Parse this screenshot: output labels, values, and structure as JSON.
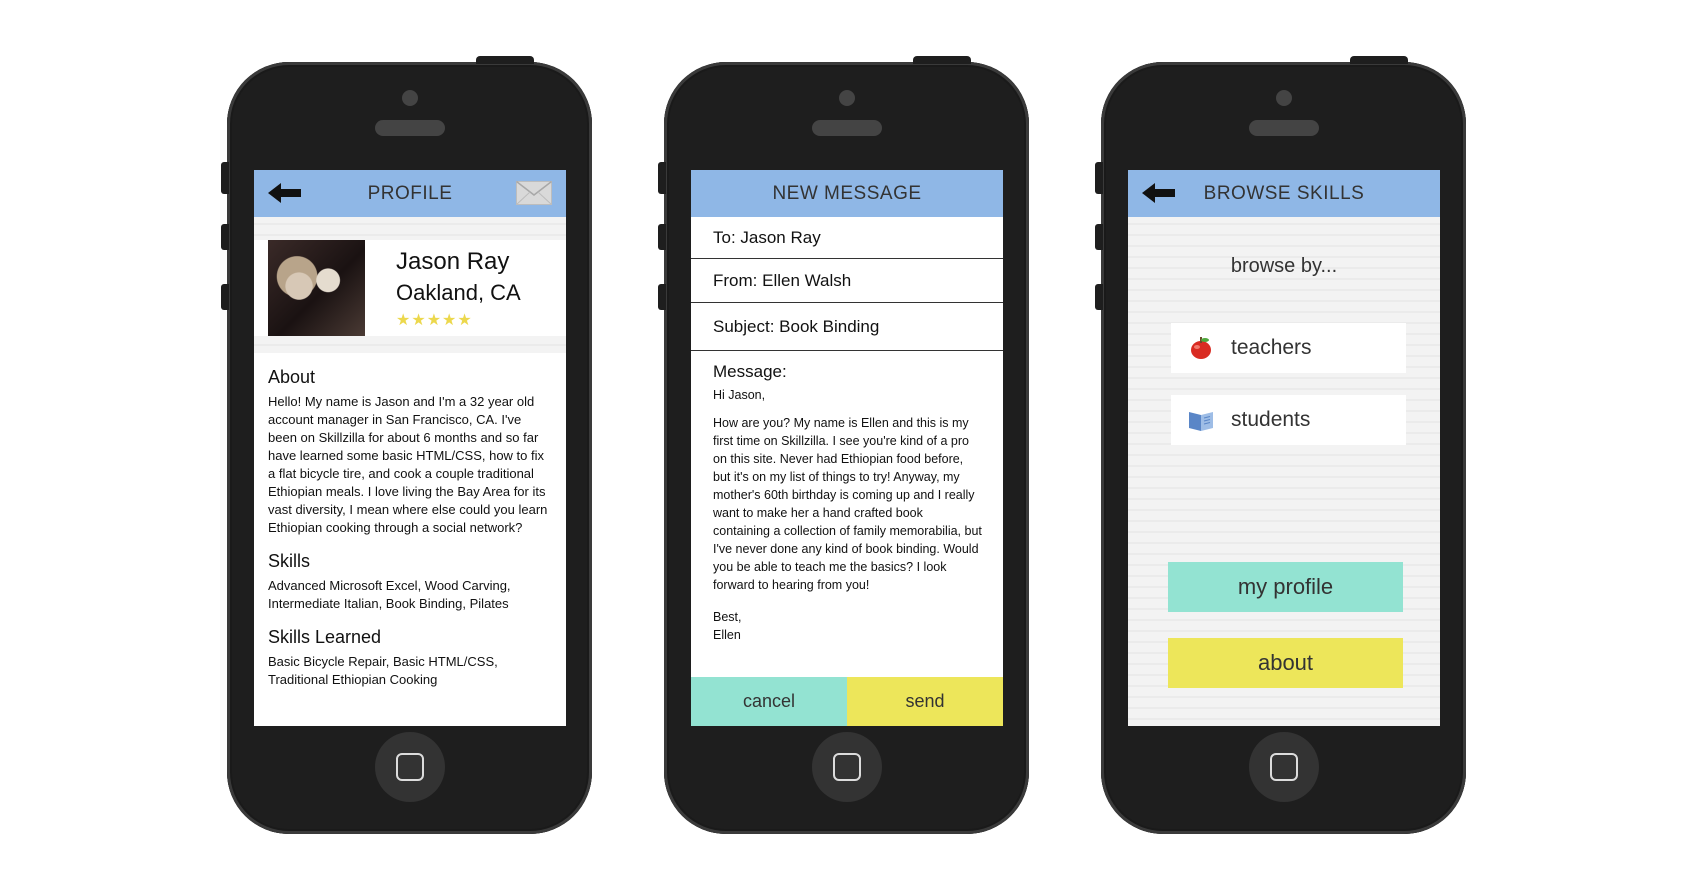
{
  "phones": {
    "profile": {
      "title": "PROFILE",
      "back_icon": "back-arrow-icon",
      "mail_icon": "envelope-icon",
      "name": "Jason Ray",
      "location": "Oakland, CA",
      "rating": {
        "stars_display": "★★★★★",
        "stars_filled": 5,
        "stars_total": 5
      },
      "about_title": "About",
      "about_text": "Hello! My name is Jason and I'm a 32 year old account manager in San Francisco, CA. I've been on Skillzilla for about 6 months and so far have learned some basic HTML/CSS, how to fix a flat bicycle tire, and cook a couple traditional Ethiopian meals. I love living the Bay Area for its vast diversity, I mean where else could you learn Ethiopian cooking through a social network?",
      "skills_title": "Skills",
      "skills_text": "Advanced Microsoft Excel, Wood Carving, Intermediate Italian, Book Binding, Pilates",
      "learned_title": "Skills Learned",
      "learned_text": "Basic Bicycle Repair, Basic HTML/CSS, Traditional Ethiopian Cooking"
    },
    "message": {
      "title": "NEW MESSAGE",
      "to": "To: Jason Ray",
      "from": "From: Ellen Walsh",
      "subject": "Subject: Book Binding",
      "message_label": "Message:",
      "greeting": "Hi Jason,",
      "body": "How are you? My name is Ellen and this is my first time on Skillzilla. I see you're kind of a pro on this site. Never had Ethiopian food before, but it's on my list of things to try! Anyway, my mother's 60th birthday is coming up and I really want to make her a hand crafted book containing a collection of family memorabilia, but I've never done any kind of book binding. Would you be able to teach me the basics? I look forward to hearing from you!",
      "signoff": "Best,\nEllen",
      "cancel_label": "cancel",
      "send_label": "send"
    },
    "browse": {
      "title": "BROWSE SKILLS",
      "back_icon": "back-arrow-icon",
      "browse_by": "browse by...",
      "teachers_label": "teachers",
      "teachers_icon": "apple-icon",
      "students_label": "students",
      "students_icon": "book-icon",
      "my_profile_label": "my profile",
      "about_label": "about"
    }
  },
  "colors": {
    "header": "#8fb7e6",
    "teal": "#93e3d2",
    "yellow": "#ede65a",
    "star": "#ecd84d",
    "phone_body": "#1e1e1e"
  }
}
